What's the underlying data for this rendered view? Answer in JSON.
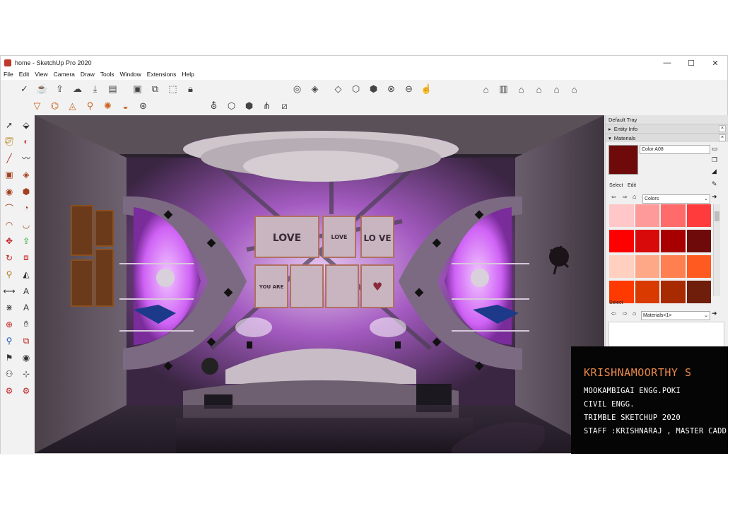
{
  "window": {
    "title": "home - SketchUp Pro 2020",
    "minimize_glyph": "—",
    "maximize_glyph": "☐",
    "close_glyph": "✕"
  },
  "menu": [
    "File",
    "Edit",
    "View",
    "Camera",
    "Draw",
    "Tools",
    "Window",
    "Extensions",
    "Help"
  ],
  "toolbar": {
    "row1_left": [
      "account-icon",
      "teapot-icon",
      "share-model-icon",
      "cloud-icon",
      "import-icon",
      "export-icon",
      "layout-icon",
      "generate-report-icon",
      "preview-icon",
      "lock-icon"
    ],
    "row1_mid": [
      "x-ray-icon",
      "back-edges-icon",
      "wireframe-icon",
      "hidden-line-icon",
      "shaded-icon",
      "shaded-textures-icon",
      "monochrome-icon",
      "section-icon"
    ],
    "row1_right": [
      "iso-view-icon",
      "top-view-icon",
      "front-view-icon",
      "right-view-icon",
      "back-view-icon",
      "left-view-icon"
    ],
    "row2_left": [
      "terrain-tool-1-icon",
      "terrain-tool-2-icon",
      "terrain-tool-3-icon",
      "terrain-tool-4-icon",
      "terrain-tool-5-icon",
      "terrain-tool-6-icon",
      "terrain-tool-7-icon"
    ],
    "row2_mid": [
      "solid-tools-icon",
      "box-icon",
      "outer-shell-icon",
      "intersect-icon",
      "trim-icon"
    ]
  },
  "left_tools": [
    "select-icon",
    "eraser-icon",
    "paint-bucket-icon",
    "follow-me-icon",
    "line-icon",
    "freehand-icon",
    "rectangle-icon",
    "rotated-rect-icon",
    "circle-icon",
    "polygon-icon",
    "arc-icon",
    "pie-icon",
    "three-point-arc-icon",
    "two-point-arc-icon",
    "move-icon",
    "push-pull-icon",
    "rotate-icon",
    "offset-icon",
    "tape-icon",
    "protractor-icon",
    "dimension-icon",
    "text-icon",
    "axes-icon",
    "3d-text-icon",
    "orbit-icon",
    "pan-icon",
    "zoom-icon",
    "zoom-window-icon",
    "position-camera-icon",
    "look-around-icon",
    "walk-icon",
    "section-plane-icon",
    "sandbox-icon",
    "warehouse-icon"
  ],
  "tray": {
    "title": "Default Tray",
    "entity_info_label": "Entity Info",
    "materials_label": "Materials",
    "material_name": "Color A08",
    "current_color": "#6e0a0a",
    "tabs": [
      "Select",
      "Edit"
    ],
    "library": "Colors",
    "lower_select_label": "Select",
    "lower_library": "Materials<1>",
    "swatches": [
      "#ffc7c7",
      "#ff9a9a",
      "#ff6a6a",
      "#ff3b3b",
      "#ff0000",
      "#d80a0a",
      "#a80000",
      "#6e0a0a",
      "#ffcfc0",
      "#ffa888",
      "#ff7f50",
      "#ff5a1f",
      "#ff3a00",
      "#d83a00",
      "#a82a00",
      "#6e1e0a"
    ]
  },
  "credit": {
    "name": "KRISHNAMOORTHY S",
    "line1": "MOOKAMBIGAI ENGG.POKI",
    "line2": "CIVIL ENGG.",
    "line3": "TRIMBLE SKETCHUP 2020",
    "line4": "STAFF :KRISHNARAJ , MASTER CADD"
  },
  "scene": {
    "frame_texts": [
      "LOVE",
      "LOVE",
      "LO VE",
      "YOU ARE",
      "♥"
    ],
    "accent": "#c93cf0"
  }
}
